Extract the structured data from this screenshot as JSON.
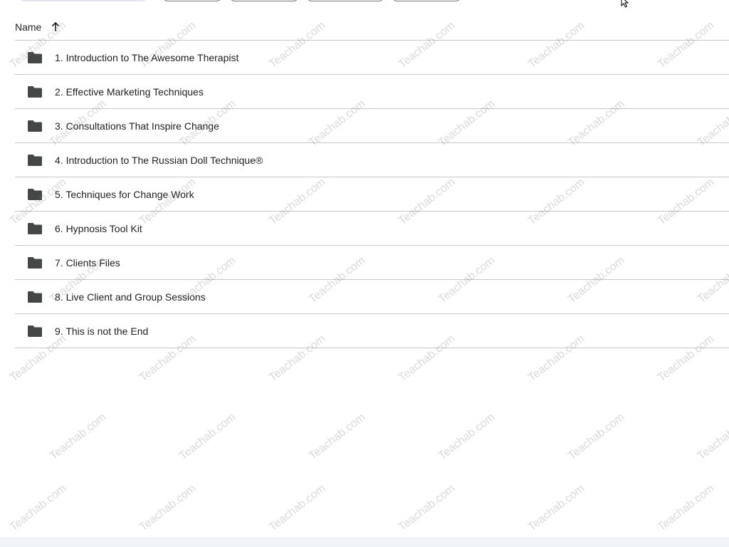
{
  "header": {
    "name_label": "Name",
    "sort_icon": "arrow-up-icon"
  },
  "folders": [
    {
      "label": "1. Introduction to The Awesome Therapist"
    },
    {
      "label": "2. Effective Marketing Techniques"
    },
    {
      "label": "3. Consultations That Inspire Change"
    },
    {
      "label": "4. Introduction to The Russian Doll Technique®"
    },
    {
      "label": "5. Techniques for Change Work"
    },
    {
      "label": "6. Hypnosis Tool Kit"
    },
    {
      "label": "7. Clients Files"
    },
    {
      "label": "8. Live Client and Group Sessions"
    },
    {
      "label": "9. This is not the End"
    }
  ],
  "watermark": {
    "text": "Teachab.com"
  },
  "colors": {
    "divider": "#c7c7c7",
    "folder_icon": "#444746",
    "text": "#1f1f1f"
  }
}
